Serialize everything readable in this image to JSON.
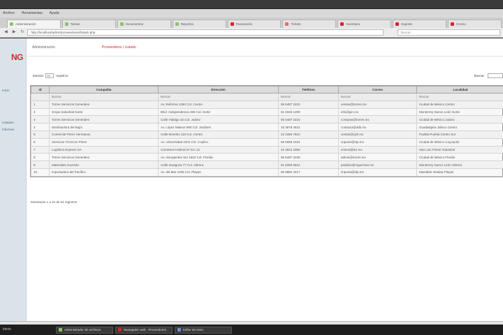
{
  "browser": {
    "menu": [
      "Archivo",
      "Herramientas",
      "Ayuda"
    ],
    "tabs": [
      {
        "label": "Administración",
        "color": "#8dc26f"
      },
      {
        "label": "Tareas",
        "color": "#8dc26f"
      },
      {
        "label": "Documentos",
        "color": "#8dc26f"
      },
      {
        "label": "Reportes",
        "color": "#8dc26f"
      },
      {
        "label": "Facturación",
        "color": "#d4262b"
      },
      {
        "label": "Tickets",
        "color": "#e07070"
      },
      {
        "label": "Inventario",
        "color": "#d4262b"
      },
      {
        "label": "Soporte",
        "color": "#d4262b"
      },
      {
        "label": "Correo",
        "color": "#d4262b"
      }
    ],
    "url": "http://localhost/admin/proveedores/listado.php",
    "search_placeholder": "Buscar",
    "back_glyph": "◀",
    "forward_glyph": "▶",
    "reload_glyph": "↻"
  },
  "app": {
    "logo_text": "NG",
    "sidebar_links": [
      "Inicio",
      "Listados",
      "Informes"
    ],
    "top_nav": [
      {
        "label": "Administración"
      },
      {
        "label": "Proveedores / Listado",
        "current": true
      }
    ]
  },
  "table_controls": {
    "show_label": "Mostrar",
    "records_value": "10",
    "records_label": "registros",
    "search_label": "Buscar:"
  },
  "table": {
    "columns": [
      "Id",
      "Compañía",
      "Dirección",
      "Teléfono",
      "Correo",
      "Localidad"
    ],
    "filter_row": [
      "",
      "Buscar",
      "Buscar",
      "Buscar",
      "Buscar",
      "Buscar"
    ],
    "rows": [
      [
        "1",
        "Torres Servicios Generales",
        "Av. Reforma 1250 Col. Centro",
        "55 5487 2210",
        "ventas@torres.mx",
        "Ciudad de México Centro"
      ],
      [
        "2",
        "Grupo Industrial Norte",
        "Blvd. Independencia 455 Col. Norte",
        "81 8345 1290",
        "info@gin.mx",
        "Monterrey Nuevo León Norte"
      ],
      [
        "3",
        "Torres Servicios Generales",
        "Calle Hidalgo 32 Col. Juárez",
        "55 5487 2215",
        "compras@torres.mx",
        "Ciudad de México Juárez"
      ],
      [
        "4",
        "Distribuidora del Bajío",
        "Av. López Mateos 980 Col. Jardines",
        "33 3678 4521",
        "contacto@ddb.mx",
        "Guadalajara Jalisco Centro"
      ],
      [
        "5",
        "Comercial Pérez Hermanos",
        "Calle Morelos 118 Col. Centro",
        "22 2456 7810",
        "ventas@cph.mx",
        "Puebla Puebla Centro Sur"
      ],
      [
        "6",
        "Servicios Técnicos Pérez",
        "Av. Universidad 2201 Col. Copilco",
        "55 5659 1034",
        "soporte@stp.mx",
        "Ciudad de México Coyoacán"
      ],
      [
        "7",
        "Logística Express SA",
        "Carretera Federal 57 Km 12",
        "44 4812 3390",
        "envios@lex.mx",
        "San Luis Potosí Industrial"
      ],
      [
        "8",
        "Torres Servicios Generales",
        "Av. Insurgentes Sur 1602 Col. Florida",
        "55 5487 2230",
        "admin@torres.mx",
        "Ciudad de México Florida"
      ],
      [
        "9",
        "Materiales Guzmán",
        "Calle Zaragoza 77 Col. Obrera",
        "81 8390 6612",
        "pedidos@mguzman.mx",
        "Monterrey Nuevo León Obrera"
      ],
      [
        "10",
        "Importadora del Pacífico",
        "Av. del Mar 1405 Col. Playas",
        "66 9982 4417",
        "importa@idp.mx",
        "Mazatlán Sinaloa Playas"
      ]
    ]
  },
  "table_info": "Mostrando 1 a 10 de 54 registros",
  "taskbar": {
    "start_label": "Inicio",
    "items": [
      {
        "label": "Administrador de archivos",
        "color": "#8dc26f"
      },
      {
        "label": "Navegador web - Proveedores",
        "color": "#d4262b"
      },
      {
        "label": "Editor de texto",
        "color": "#6a8fd4"
      }
    ]
  }
}
